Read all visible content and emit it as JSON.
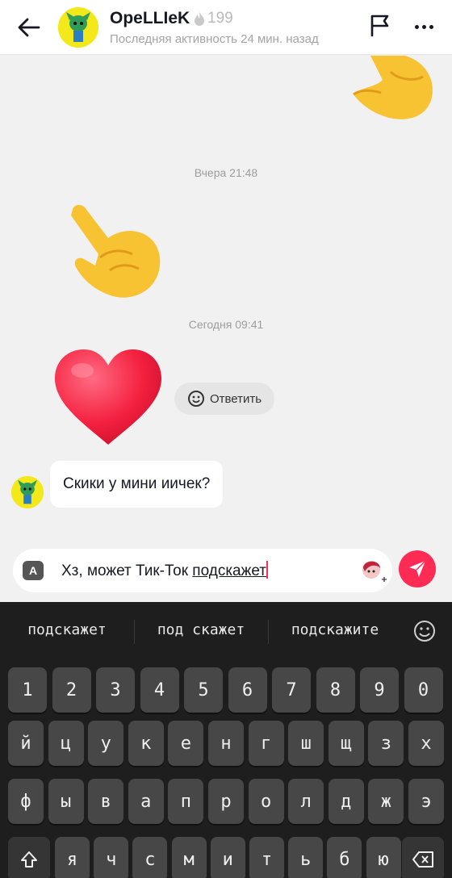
{
  "header": {
    "username": "OpeLLIeK",
    "streak_count": "199",
    "activity": "Последняя активность 24 мин. назад",
    "icons": [
      "arrow-left-icon",
      "flag-icon",
      "more-horizontal-icon"
    ]
  },
  "chat": {
    "timestamp_1": "Вчера 21:48",
    "timestamp_2": "Сегодня 09:41",
    "reply_label": "Ответить",
    "message_text": "Скики у мини иичек?",
    "emoji_messages": [
      "👇",
      "👉",
      "❤️"
    ]
  },
  "input": {
    "keyboard_switch": "A",
    "text_before": "Хз, может Тик-Ток ",
    "text_underlined": "подскажет",
    "icons": [
      "sticker-icon",
      "send-icon"
    ]
  },
  "keyboard": {
    "suggestions": [
      "подскажет",
      "под скажет",
      "подскажите"
    ],
    "row_numbers": [
      "1",
      "2",
      "3",
      "4",
      "5",
      "6",
      "7",
      "8",
      "9",
      "0"
    ],
    "row_1": [
      "й",
      "ц",
      "у",
      "к",
      "е",
      "н",
      "г",
      "ш",
      "щ",
      "з",
      "х"
    ],
    "row_2": [
      "ф",
      "ы",
      "в",
      "а",
      "п",
      "р",
      "о",
      "л",
      "д",
      "ж",
      "э"
    ],
    "row_3": [
      "я",
      "ч",
      "с",
      "м",
      "и",
      "т",
      "ь",
      "б",
      "ю"
    ],
    "colors": {
      "accent": "#fe2c55",
      "key": "#474747",
      "background": "#1e1e1e"
    }
  }
}
